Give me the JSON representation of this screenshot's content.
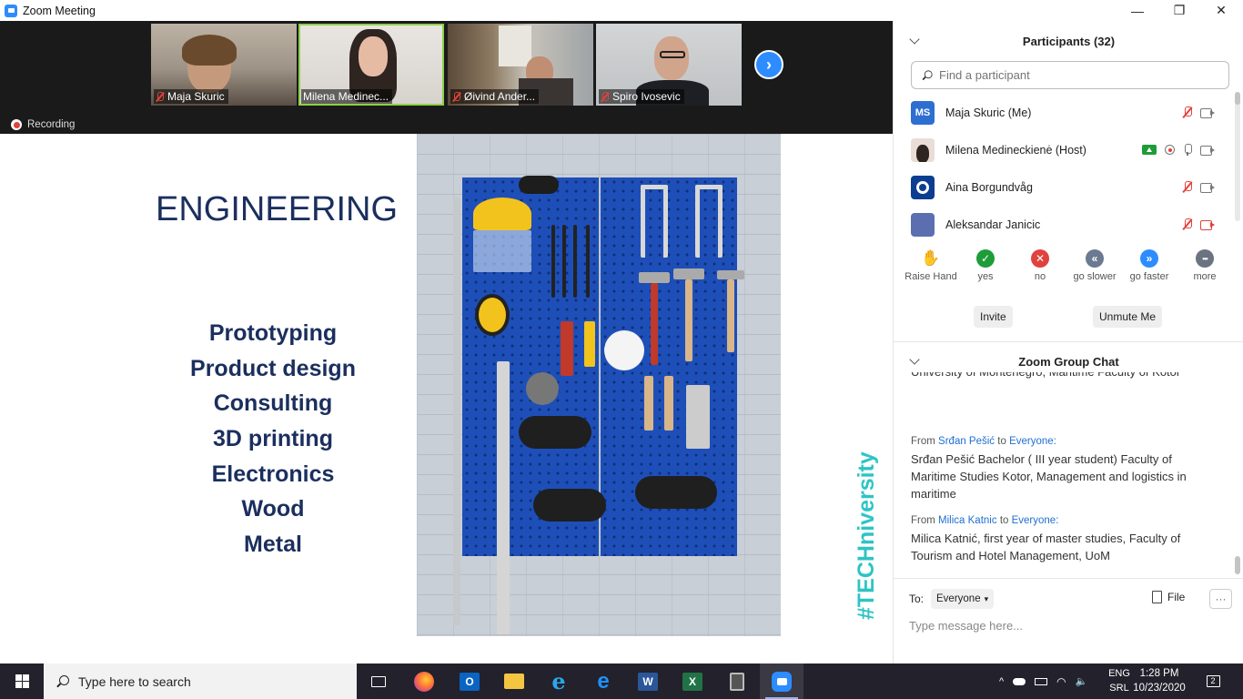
{
  "window": {
    "title": "Zoom Meeting",
    "minimize": "—",
    "maximize": "❐",
    "close": "✕"
  },
  "gallery": {
    "thumbnails": [
      {
        "name": "Maja Skuric",
        "muted": true
      },
      {
        "name": "Milena Medinec...",
        "muted": false,
        "active": true
      },
      {
        "name": "Øivind Ander...",
        "muted": true
      },
      {
        "name": "Spiro Ivosevic",
        "muted": true
      }
    ],
    "next_icon": "›",
    "recording_label": "Recording"
  },
  "slide": {
    "title": "ENGINEERING",
    "services": [
      "Prototyping",
      "Product design",
      "Consulting",
      "3D printing",
      "Electronics",
      "Wood",
      "Metal"
    ],
    "hashtag": "#TECHniversity"
  },
  "participants": {
    "header": "Participants (32)",
    "search_placeholder": "Find a participant",
    "list": [
      {
        "initials": "MS",
        "name": "Maja Skuric (Me)",
        "avatar_color": "#2d6fd1",
        "mic": "muted",
        "cam": "on"
      },
      {
        "initials": "",
        "name": "Milena Medineckienė (Host)",
        "avatar_color": "#d9c9bf",
        "mic": "on",
        "cam": "on",
        "sharing": true,
        "recording": true
      },
      {
        "initials": "",
        "name": "Aina Borgundvåg",
        "avatar_color": "#0b3d91",
        "mic": "muted",
        "cam": "on"
      },
      {
        "initials": "",
        "name": "Aleksandar Janicic",
        "avatar_color": "#5b6fb0",
        "mic": "muted",
        "cam": "off"
      }
    ]
  },
  "reactions": [
    {
      "label": "Raise Hand",
      "icon": "✋",
      "color": "#2d8cff"
    },
    {
      "label": "yes",
      "icon": "✓",
      "color": "#1f9c3a"
    },
    {
      "label": "no",
      "icon": "✕",
      "color": "#e0423c"
    },
    {
      "label": "go slower",
      "icon": "«",
      "color": "#6b7a90"
    },
    {
      "label": "go faster",
      "icon": "»",
      "color": "#2d8cff"
    },
    {
      "label": "more",
      "icon": "•••",
      "color": "#6b7380"
    }
  ],
  "actions": {
    "invite": "Invite",
    "unmute": "Unmute Me"
  },
  "chat": {
    "header": "Zoom Group Chat",
    "partial_text": "University of Montenegro, Maritime Faculty of Kotor",
    "messages": [
      {
        "from_label": "From",
        "sender": "Srđan Pešić",
        "to_label": "to",
        "recipient": "Everyone:",
        "text": "Srđan Pešić Bachelor ( III year student) Faculty of Maritime Studies Kotor, Management and logistics in maritime"
      },
      {
        "from_label": "From",
        "sender": "Milica Katnic",
        "to_label": "to",
        "recipient": "Everyone:",
        "text": "Milica Katnić, first year of master studies, Faculty of Tourism and Hotel Management, UoM"
      }
    ],
    "to_label": "To:",
    "to_value": "Everyone",
    "file_label": "File",
    "more_label": "···",
    "input_placeholder": "Type message here..."
  },
  "taskbar": {
    "search_placeholder": "Type here to search",
    "apps": [
      "task-view",
      "firefox",
      "outlook",
      "file-explorer",
      "internet-explorer",
      "edge",
      "word",
      "excel",
      "calculator",
      "zoom"
    ],
    "language": [
      "ENG",
      "SRL"
    ],
    "time": "1:28 PM",
    "date": "10/23/2020",
    "notifications": "2"
  }
}
